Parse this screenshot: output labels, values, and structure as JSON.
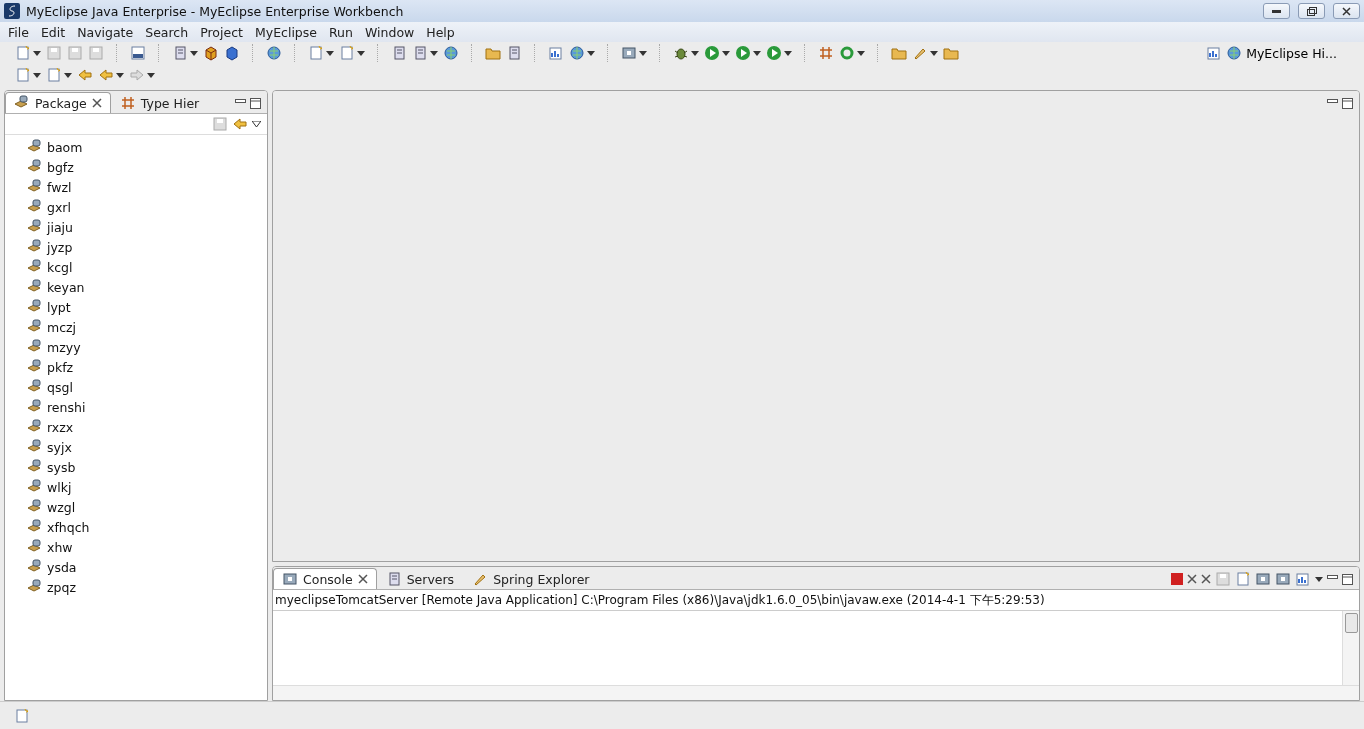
{
  "window": {
    "title": "MyEclipse Java Enterprise - MyEclipse Enterprise Workbench"
  },
  "menu": [
    "File",
    "Edit",
    "Navigate",
    "Search",
    "Project",
    "MyEclipse",
    "Run",
    "Window",
    "Help"
  ],
  "toolbar": {
    "perspective": "MyEclipse Hi..."
  },
  "left_panel": {
    "tabs": [
      {
        "label": "Package",
        "selected": true
      },
      {
        "label": "Type Hier",
        "selected": false
      }
    ],
    "tree": [
      {
        "label": "baom"
      },
      {
        "label": "bgfz"
      },
      {
        "label": "fwzl"
      },
      {
        "label": "gxrl"
      },
      {
        "label": "jiaju"
      },
      {
        "label": "jyzp"
      },
      {
        "label": "kcgl"
      },
      {
        "label": "keyan"
      },
      {
        "label": "lypt"
      },
      {
        "label": "mczj"
      },
      {
        "label": "mzyy"
      },
      {
        "label": "pkfz"
      },
      {
        "label": "qsgl"
      },
      {
        "label": "renshi"
      },
      {
        "label": "rxzx"
      },
      {
        "label": "syjx"
      },
      {
        "label": "sysb"
      },
      {
        "label": "wlkj"
      },
      {
        "label": "wzgl"
      },
      {
        "label": "xfhqch"
      },
      {
        "label": "xhw"
      },
      {
        "label": "ysda"
      },
      {
        "label": "zpqz"
      }
    ]
  },
  "console": {
    "tabs": [
      {
        "label": "Console",
        "selected": true
      },
      {
        "label": "Servers",
        "selected": false
      },
      {
        "label": "Spring Explorer",
        "selected": false
      }
    ],
    "header": "myeclipseTomcatServer [Remote Java Application] C:\\Program Files (x86)\\Java\\jdk1.6.0_05\\bin\\javaw.exe (2014-4-1 下午5:29:53)"
  }
}
